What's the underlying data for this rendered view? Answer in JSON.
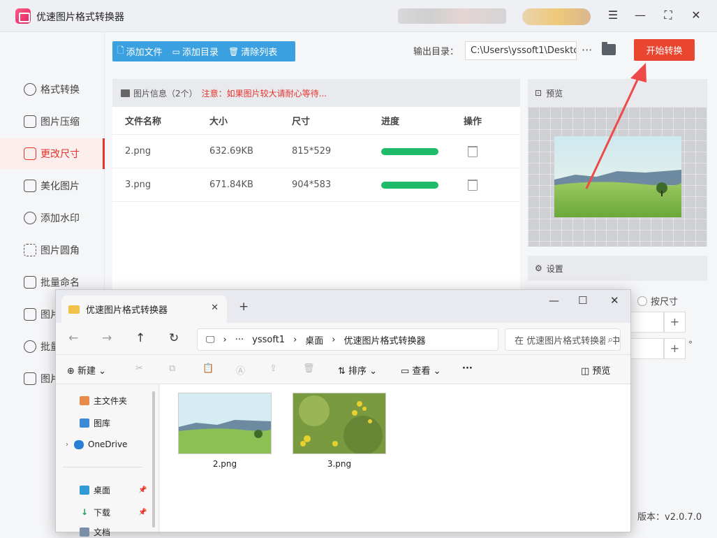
{
  "app": {
    "title": "优速图片格式转换器",
    "version": "版本：v2.0.7.0"
  },
  "sidebar": {
    "items": [
      {
        "label": "格式转换"
      },
      {
        "label": "图片压缩"
      },
      {
        "label": "更改尺寸"
      },
      {
        "label": "美化图片"
      },
      {
        "label": "添加水印"
      },
      {
        "label": "图片圆角"
      },
      {
        "label": "批量命名"
      },
      {
        "label": "图片"
      },
      {
        "label": "批量"
      },
      {
        "label": "图片"
      }
    ]
  },
  "toolbar": {
    "add_file": "添加文件",
    "add_dir": "添加目录",
    "clear_list": "清除列表"
  },
  "output": {
    "label": "输出目录：",
    "path": "C:\\Users\\yssoft1\\Deskto",
    "more": "···"
  },
  "start_button": "开始转换",
  "fileinfo": {
    "label": "图片信息（2个）",
    "warning": "注意：如果图片较大请耐心等待..."
  },
  "table": {
    "headers": [
      "文件名称",
      "大小",
      "尺寸",
      "进度",
      "操作"
    ],
    "rows": [
      {
        "name": "2.png",
        "size": "632.69KB",
        "dim": "815*529",
        "progress": 1.0
      },
      {
        "name": "3.png",
        "size": "671.84KB",
        "dim": "904*583",
        "progress": 1.0
      }
    ]
  },
  "preview": {
    "title": "预览"
  },
  "settings": {
    "title": "设置",
    "radio": "按尺寸",
    "plus": "+",
    "degree": "°"
  },
  "explorer": {
    "tab_title": "优速图片格式转换器",
    "close": "✕",
    "new_tab": "+",
    "breadcrumb": [
      "yssoft1",
      "桌面",
      "优速图片格式转换器"
    ],
    "more": "···",
    "search_placeholder": "在 优速图片格式转换器 中搜索",
    "commands": {
      "new": "新建",
      "sort": "排序",
      "view": "查看",
      "more": "···",
      "preview": "预览"
    },
    "nav": [
      {
        "label": "主文件夹"
      },
      {
        "label": "图库"
      },
      {
        "label": "OneDrive"
      },
      {
        "label": "桌面"
      },
      {
        "label": "下载"
      },
      {
        "label": "文档"
      }
    ],
    "files": [
      {
        "name": "2.png"
      },
      {
        "name": "3.png"
      }
    ]
  },
  "colors": {
    "accent": "#e9452f",
    "toolbar": "#3aa0e0",
    "progress": "#1dbb6a",
    "active": "#e5342b"
  }
}
